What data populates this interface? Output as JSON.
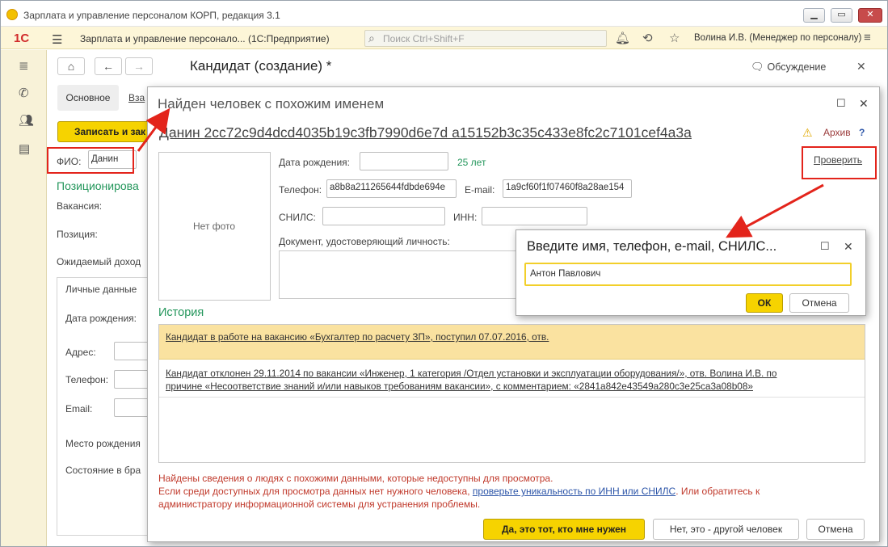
{
  "window": {
    "title": "Зарплата и управление персоналом КОРП, редакция 3.1"
  },
  "appbar": {
    "logo": "1С",
    "title": "Зарплата и управление персонало... (1С:Предприятие)",
    "search_placeholder": "Поиск Ctrl+Shift+F",
    "user": "Волина И.В. (Менеджер по персоналу)"
  },
  "form": {
    "title": "Кандидат (создание) *",
    "discussion": "Обсуждение",
    "tab_main": "Основное",
    "tab_link": "Вза",
    "save_button": "Записать и зак",
    "fio_label": "ФИО:",
    "fio_value": "Данин",
    "section_position": "Позиционирова",
    "vacancy_label": "Вакансия:",
    "position_label": "Позиция:",
    "income_label": "Ожидаемый доход",
    "personal_tab": "Личные данные",
    "birth_label": "Дата рождения:",
    "address_label": "Адрес:",
    "phone_label": "Телефон:",
    "email_label": "Email:",
    "birthplace_label": "Место рождения",
    "marital_label": "Состояние в бра"
  },
  "dialog": {
    "title": "Найден человек с похожим именем",
    "person_link": "Данин 2cc72c9d4dcd4035b19c3fb7990d6e7d a15152b3c35c433e8fc2c7101cef4a3a",
    "archive": "Архив",
    "help": "?",
    "photo": "Нет фото",
    "birth_label": "Дата рождения:",
    "birth_value": "",
    "age": "25 лет",
    "check_link": "Проверить",
    "phone_label": "Телефон:",
    "phone_value": "a8b8a211265644fdbde694e",
    "email_label": "E-mail:",
    "email_value": "1a9cf60f1f07460f8a28ae154",
    "snils_label": "СНИЛС:",
    "inn_label": "ИНН:",
    "doc_label": "Документ, удостоверяющий личность:",
    "history_title": "История",
    "history": [
      {
        "text": "Кандидат в работе на вакансию «Бухгалтер по расчету ЗП», поступил 07.07.2016, отв."
      },
      {
        "line1": "Кандидат отклонен 29.11.2014 по вакансии «Инженер, 1 категория /Отдел установки и эксплуатации оборудования/», отв. Волина И.В. по",
        "line2": "причине «Несоответствие знаний и/или навыков требованиям вакансии», с комментарием: «2841a842e43549a280c3e25ca3a08b08»"
      }
    ],
    "warn_line1": "Найдены сведения о людях с похожими данными, которые недоступны для просмотра.",
    "warn_line2_a": "Если среди доступных для просмотра данных нет нужного человека, ",
    "warn_line2_link": "проверьте уникальность по ИНН или СНИЛС",
    "warn_line2_b": ". Или обратитесь к",
    "warn_line3": "администратору информационной системы для устранения проблемы.",
    "btn_yes": "Да, это тот, кто мне нужен",
    "btn_no": "Нет, это - другой человек",
    "btn_cancel": "Отмена"
  },
  "search_dialog": {
    "title": "Введите имя, телефон, e-mail, СНИЛС...",
    "value": "Антон Павлович",
    "ok": "ОК",
    "cancel": "Отмена"
  },
  "colors": {
    "accent": "#f6d300",
    "link": "#2c55a8",
    "green": "#23965b",
    "error": "#c0392b",
    "annotation": "#e3241b"
  }
}
